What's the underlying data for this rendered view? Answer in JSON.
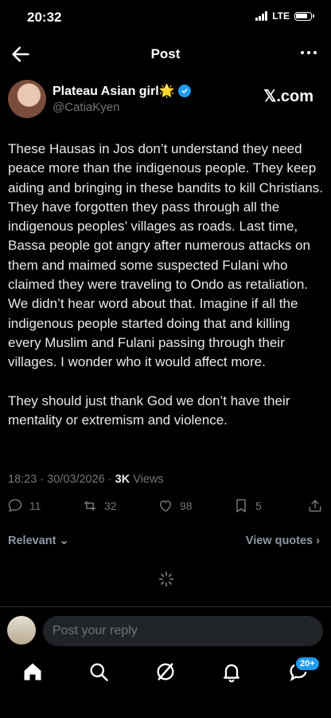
{
  "status": {
    "time": "20:32",
    "network": "LTE"
  },
  "header": {
    "title": "Post"
  },
  "author": {
    "name": "Plateau Asian girl🌟",
    "handle": "@CatiaKyen",
    "source": "𝕏.com"
  },
  "tweet": {
    "paragraphs": [
      "These Hausas in Jos don’t understand they need peace more than the indigenous people. They keep aiding and bringing in these bandits to kill Christians. They have forgotten they pass through all the indigenous peoples’ villages as roads. Last time, Bassa people got angry after numerous attacks on them and maimed some suspected Fulani who claimed they were traveling to Ondo as retaliation. We didn’t hear word about that. Imagine if all the indigenous people started doing that and killing every Muslim and Fulani passing through their villages. I wonder who it would affect more.",
      "They should just thank God we don’t have their mentality or extremism and violence."
    ]
  },
  "meta": {
    "timestamp": "18:23 · 30/03/2026 · ",
    "views_count": "3K",
    "views_label": " Views"
  },
  "actions": {
    "replies": "11",
    "reposts": "32",
    "likes": "98",
    "bookmarks": "5"
  },
  "sort": {
    "relevant": "Relevant",
    "view_quotes": "View quotes"
  },
  "reply": {
    "placeholder": "Post your reply"
  },
  "nav": {
    "messages_badge": "20+"
  },
  "colors": {
    "accent": "#1d9bf0",
    "muted": "#71767b",
    "background": "#000000"
  }
}
